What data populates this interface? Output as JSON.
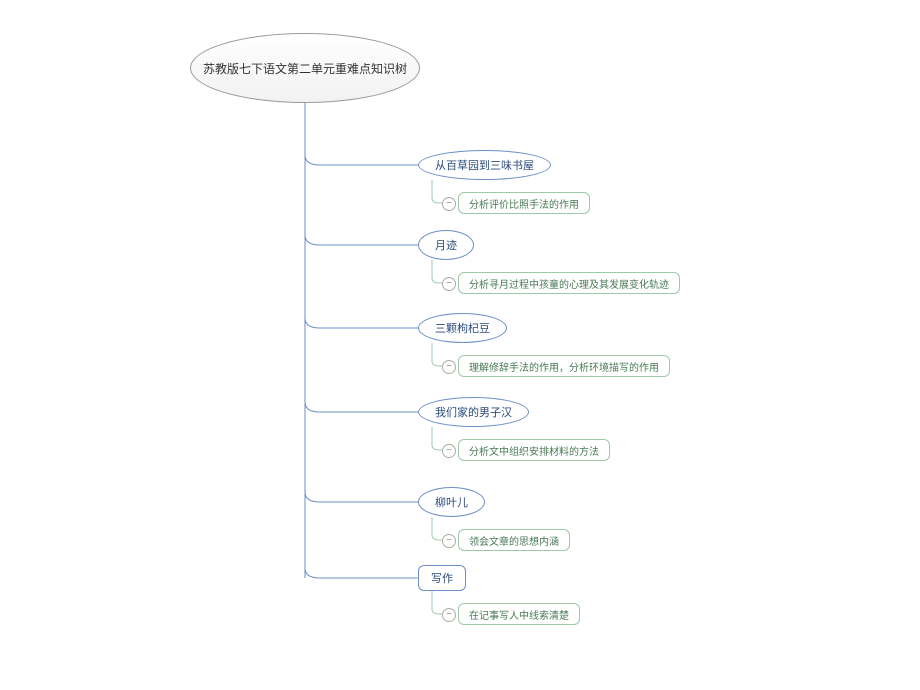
{
  "root": {
    "label": "苏教版七下语文第二单元重难点知识树"
  },
  "topics": [
    {
      "label": "从百草园到三味书屋",
      "leaf": "分析评价比照手法的作用"
    },
    {
      "label": "月迹",
      "leaf": "分析寻月过程中孩童的心理及其发展变化轨迹"
    },
    {
      "label": "三颗枸杞豆",
      "leaf": "理解修辞手法的作用，分析环境描写的作用"
    },
    {
      "label": "我们家的男子汉",
      "leaf": "分析文中组织安排材料的方法"
    },
    {
      "label": "柳叶儿",
      "leaf": "领会文章的思想内涵"
    },
    {
      "label": "写作",
      "leaf": "在记事写人中线索清楚"
    }
  ],
  "collapse_glyph": "−",
  "colors": {
    "root_border": "#999999",
    "topic_border": "#6d8fc5",
    "leaf_border": "#9ec9a9",
    "line": "#6d8fc5",
    "leaf_line": "#9ec9a9"
  }
}
